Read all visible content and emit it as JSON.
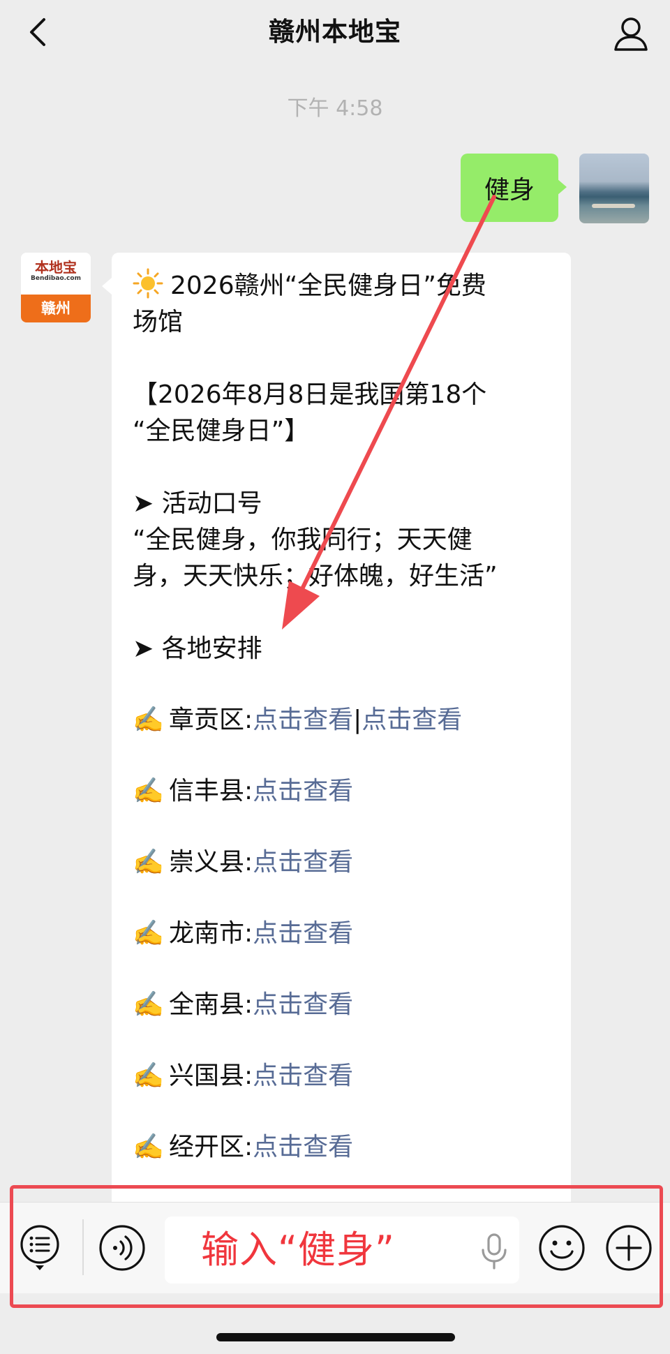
{
  "header": {
    "title": "赣州本地宝",
    "back_icon": "chevron-left-icon",
    "profile_icon": "person-icon"
  },
  "chat": {
    "time": "下午 4:58",
    "user_message": "健身",
    "bot_avatar": {
      "logo_text": "本地宝",
      "logo_sub": "Bendibao.com",
      "city": "赣州"
    },
    "bot_message": {
      "title_line1": "2026赣州“全民健身日”免费",
      "title_line2": "场馆",
      "notice_line1": "【2026年8月8日是我国第18个",
      "notice_line2": "“全民健身日”】",
      "slogan_heading": "➤ 活动口号",
      "slogan_line1": "“全民健身，你我同行；天天健",
      "slogan_line2": "身，天天快乐；好体魄，好生活”",
      "arrange_heading": "➤ 各地安排",
      "hand_emoji": "✍️",
      "districts": [
        {
          "name": "章贡区:",
          "link1": "点击查看",
          "separator": "|",
          "link2": "点击查看"
        },
        {
          "name": "信丰县:",
          "link1": "点击查看"
        },
        {
          "name": "崇义县:",
          "link1": "点击查看"
        },
        {
          "name": "龙南市:",
          "link1": "点击查看"
        },
        {
          "name": "全南县:",
          "link1": "点击查看"
        },
        {
          "name": "兴国县:",
          "link1": "点击查看"
        },
        {
          "name": "经开区:",
          "link1": "点击查看"
        }
      ]
    }
  },
  "input_bar": {
    "hint_text": "输入“健身”",
    "icons": [
      "menu-icon",
      "voice-icon",
      "mic-icon",
      "emoji-icon",
      "plus-icon"
    ]
  },
  "colors": {
    "user_bubble": "#95ec69",
    "link": "#576b95",
    "annotation_red": "#ec4a52",
    "background": "#ededed"
  }
}
